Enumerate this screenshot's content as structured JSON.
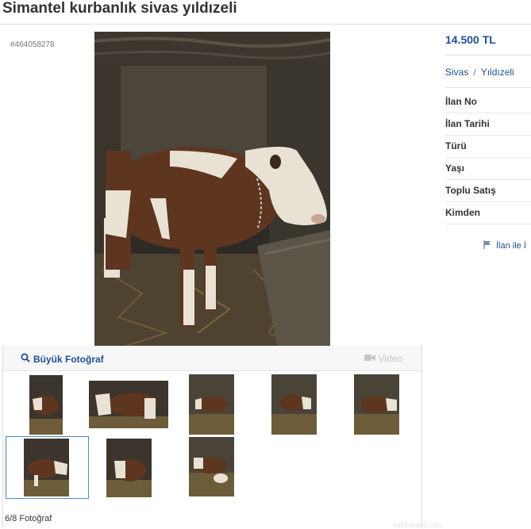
{
  "listing": {
    "title": "Simantel kurbanlık sivas yıldızeli",
    "id": "#464058278",
    "price": "14.500 TL",
    "location": {
      "city": "Sivas",
      "separator": "/",
      "district": "Yıldızeli"
    },
    "info_labels": [
      "İlan No",
      "İlan Tarihi",
      "Türü",
      "Yaşı",
      "Toplu Satış",
      "Kimden"
    ],
    "report_label": "İlan ile İ"
  },
  "gallery": {
    "big_photo_label": "Büyük Fotoğraf",
    "video_label": "Video",
    "counter": "6/8 Fotoğraf",
    "selected_index": 6,
    "total": 8
  },
  "watermark": "sahibinden.com",
  "colors": {
    "link_blue": "#1f4f93",
    "cow_brown": "#5e3620",
    "cow_white": "#e9e2d4",
    "barn_dark": "#2e2a25",
    "straw": "#6d5c3a"
  },
  "icons": {
    "big_photo": "magnifier-icon",
    "video": "camera-icon",
    "report": "flag-icon"
  }
}
